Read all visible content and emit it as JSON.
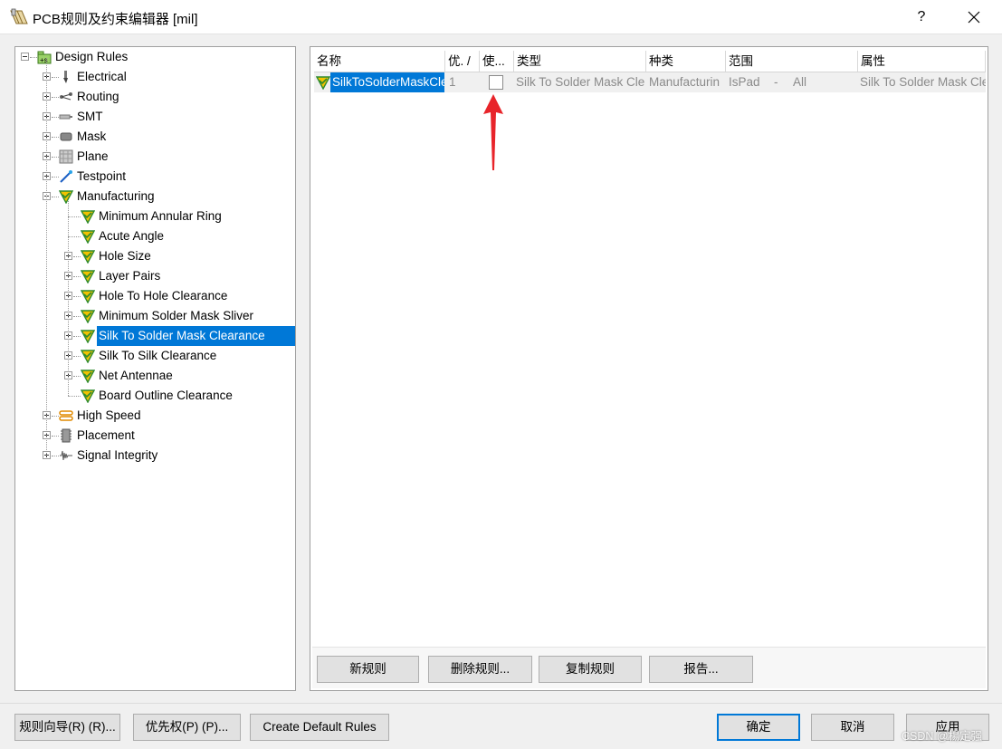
{
  "window": {
    "title": "PCB规则及约束编辑器 [mil]",
    "help_label": "?"
  },
  "tree": {
    "root": {
      "label": "Design Rules",
      "icon": "design-rules-icon"
    },
    "categories": [
      {
        "label": "Electrical",
        "icon": "electrical-icon",
        "expanded": false
      },
      {
        "label": "Routing",
        "icon": "routing-icon",
        "expanded": false
      },
      {
        "label": "SMT",
        "icon": "smt-icon",
        "expanded": false
      },
      {
        "label": "Mask",
        "icon": "mask-icon",
        "expanded": false
      },
      {
        "label": "Plane",
        "icon": "plane-icon",
        "expanded": false
      },
      {
        "label": "Testpoint",
        "icon": "testpoint-icon",
        "expanded": false
      },
      {
        "label": "Manufacturing",
        "icon": "manufacturing-icon",
        "expanded": true
      },
      {
        "label": "High Speed",
        "icon": "high-speed-icon",
        "expanded": false
      },
      {
        "label": "Placement",
        "icon": "placement-icon",
        "expanded": false
      },
      {
        "label": "Signal Integrity",
        "icon": "signal-integrity-icon",
        "expanded": false
      }
    ],
    "manufacturing_children": [
      {
        "label": "Minimum Annular Ring",
        "has_children": false,
        "selected": false
      },
      {
        "label": "Acute Angle",
        "has_children": false,
        "selected": false
      },
      {
        "label": "Hole Size",
        "has_children": true,
        "selected": false
      },
      {
        "label": "Layer Pairs",
        "has_children": true,
        "selected": false
      },
      {
        "label": "Hole To Hole Clearance",
        "has_children": true,
        "selected": false
      },
      {
        "label": "Minimum Solder Mask Sliver",
        "has_children": true,
        "selected": false
      },
      {
        "label": "Silk To Solder Mask Clearance",
        "has_children": true,
        "selected": true
      },
      {
        "label": "Silk To Silk Clearance",
        "has_children": true,
        "selected": false
      },
      {
        "label": "Net Antennae",
        "has_children": true,
        "selected": false
      },
      {
        "label": "Board Outline Clearance",
        "has_children": false,
        "selected": false
      }
    ]
  },
  "grid": {
    "columns": [
      "名称",
      "优. /",
      "使...",
      "类型",
      "种类",
      "范围",
      "属性"
    ],
    "row": {
      "name": "SilkToSolderMaskCle",
      "priority": "1",
      "enabled": false,
      "type": "Silk To Solder Mask Cle",
      "category": "Manufacturin",
      "scope": "IsPad",
      "scope_sep": "-",
      "scope2": "All",
      "attributes": "Silk To Solder Mask Cle"
    },
    "buttons": {
      "new_rule": "新规则",
      "delete_rule": "删除规则...",
      "copy_rule": "复制规则",
      "report": "报告..."
    }
  },
  "footer": {
    "wizard": "规则向导(R) (R)...",
    "priority": "优先权(P) (P)...",
    "create_default": "Create Default Rules",
    "ok": "确定",
    "cancel": "取消",
    "apply": "应用"
  },
  "watermark": "CSDN @楊定强",
  "colors": {
    "selection": "#0078d7",
    "annotation_arrow": "#e8242a",
    "rule_icon_green": "#2e8b2e",
    "rule_icon_yellow": "#f2c200"
  }
}
